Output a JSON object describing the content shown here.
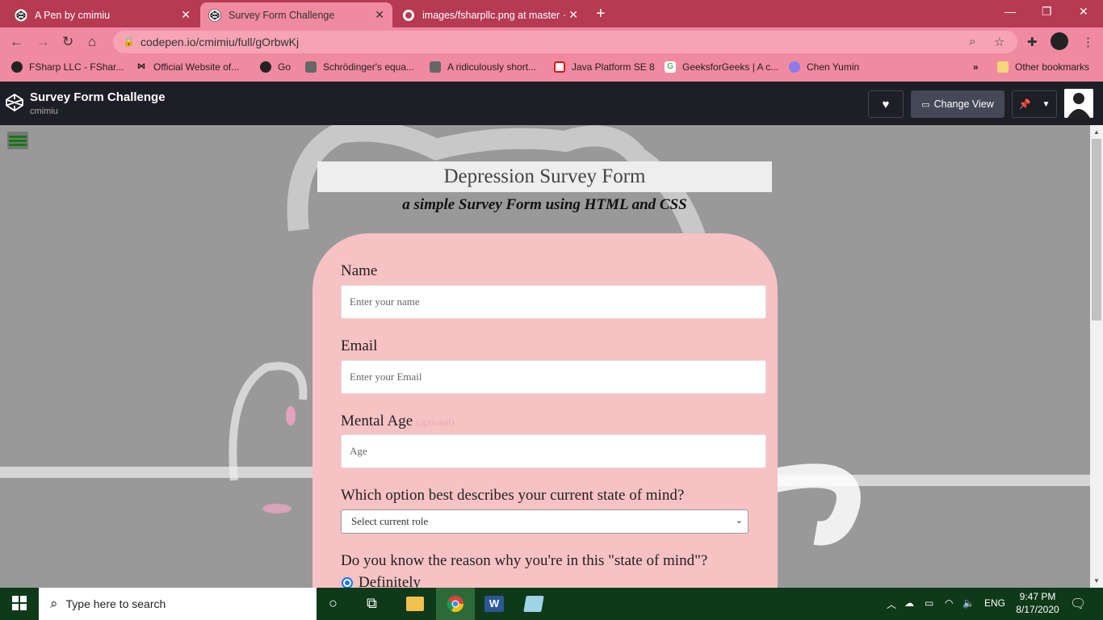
{
  "browser": {
    "tabs": [
      {
        "title": "A Pen by cmimiu",
        "active": false
      },
      {
        "title": "Survey Form Challenge",
        "active": true
      },
      {
        "title": "images/fsharpllc.png at master ·",
        "active": false
      }
    ],
    "url": "codepen.io/cmimiu/full/gOrbwKj",
    "bookmarks": [
      "FSharp LLC - FShar...",
      "Official Website of...",
      "Go",
      "Schrödinger's equa...",
      "A ridiculously short...",
      "Java Platform SE 8",
      "GeeksforGeeks | A c...",
      "Chen Yumin"
    ],
    "other_bookmarks": "Other bookmarks",
    "overflow": "»"
  },
  "codepen": {
    "title": "Survey Form Challenge",
    "user": "cmimiu",
    "change_view": "Change View"
  },
  "form": {
    "heading": "Depression Survey Form",
    "subheading": "a simple Survey Form using HTML and CSS",
    "name_label": "Name",
    "name_placeholder": "Enter your name",
    "email_label": "Email",
    "email_placeholder": "Enter your Email",
    "age_label": "Mental Age",
    "age_optional": "(optional)",
    "age_placeholder": "Age",
    "state_label": "Which option best describes your current state of mind?",
    "state_select": "Select current role",
    "reason_label": "Do you know the reason why you're in this \"state of mind\"?",
    "reason_option_1": "Definitely"
  },
  "taskbar": {
    "search_placeholder": "Type here to search",
    "lang": "ENG",
    "time": "9:47 PM",
    "date": "8/17/2020"
  }
}
